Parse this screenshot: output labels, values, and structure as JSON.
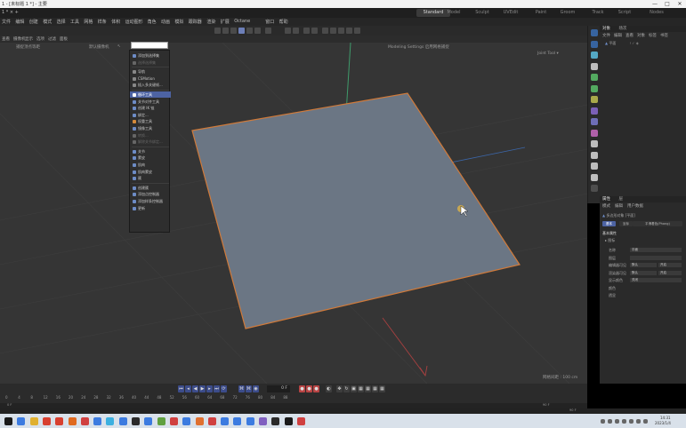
{
  "window": {
    "title": "1 - [未标题 1 *] - 主要",
    "controls": [
      "—",
      "□",
      "✕"
    ]
  },
  "tabbar": {
    "left_text": "1 *  ×  +",
    "layouts": [
      "Standard",
      "Model",
      "Sculpt",
      "UVEdit",
      "Paint",
      "Groom",
      "Track",
      "Script",
      "Nodes"
    ],
    "active_layout": "Standard"
  },
  "menubar": {
    "items": [
      "文件",
      "编辑",
      "创建",
      "模式",
      "选择",
      "工具",
      "网格",
      "样条",
      "体积",
      "运动图形",
      "角色",
      "动画",
      "模拟",
      "跟踪器",
      "渲染",
      "扩展",
      "Octane",
      "窗口",
      "帮助"
    ]
  },
  "viewport": {
    "menu": [
      "查看",
      "摄像机",
      "显示",
      "选项",
      "过滤",
      "面板"
    ],
    "camera_label": "默认摄像机",
    "snap_label": "捕捉顶点等距",
    "title": "Modeling Settings 启用网格捕捉",
    "right_label": "Joint Tool ▾",
    "grid_spacing": "网格间距 : 100 cm"
  },
  "popup": {
    "search_placeholder": "",
    "items": [
      {
        "label": "添加到选择集",
        "style": "normal",
        "icon_color": "#6d8cc6"
      },
      {
        "label": "选择选择集",
        "style": "dim",
        "icon_color": "#666"
      },
      {
        "label": "导航",
        "style": "normal",
        "icon_color": "#888"
      },
      {
        "label": "CSMotion",
        "style": "normal",
        "icon_color": "#888"
      },
      {
        "label": "插入多关键帧...",
        "style": "normal",
        "icon_color": "#888"
      },
      {
        "label": "循环工具",
        "style": "highlight",
        "icon_color": "#ffffff"
      },
      {
        "label": "关节对齐工具",
        "style": "normal",
        "icon_color": "#6d8cc6"
      },
      {
        "label": "创建 IK 链",
        "style": "normal",
        "icon_color": "#6d8cc6"
      },
      {
        "label": "绑定...",
        "style": "normal",
        "icon_color": "#6d8cc6"
      },
      {
        "label": "权重工具",
        "style": "normal",
        "icon_color": "#d48a3a"
      },
      {
        "label": "镜像工具",
        "style": "normal",
        "icon_color": "#6d8cc6"
      },
      {
        "label": "转换...",
        "style": "dim",
        "icon_color": "#666"
      },
      {
        "label": "解除关节绑定...",
        "style": "dim",
        "icon_color": "#666"
      },
      {
        "label": "关节",
        "style": "normal",
        "icon_color": "#6d8cc6"
      },
      {
        "label": "蒙皮",
        "style": "normal",
        "icon_color": "#6d8cc6"
      },
      {
        "label": "肌肉",
        "style": "normal",
        "icon_color": "#6d8cc6"
      },
      {
        "label": "肌肉蒙皮",
        "style": "normal",
        "icon_color": "#6d8cc6"
      },
      {
        "label": "簇",
        "style": "normal",
        "icon_color": "#6d8cc6"
      },
      {
        "label": "创建簇",
        "style": "normal",
        "icon_color": "#6d8cc6"
      },
      {
        "label": "添加点控制器",
        "style": "normal",
        "icon_color": "#6d8cc6"
      },
      {
        "label": "添加样条控制器",
        "style": "normal",
        "icon_color": "#6d8cc6"
      },
      {
        "label": "更新",
        "style": "normal",
        "icon_color": "#6d8cc6"
      }
    ]
  },
  "objects_panel": {
    "tabs": [
      "对象",
      "场次"
    ],
    "menu": [
      "文件",
      "编辑",
      "查看",
      "对象",
      "标签",
      "书签"
    ],
    "items": [
      {
        "name": "平面"
      }
    ]
  },
  "attributes_panel": {
    "tabs": [
      "属性",
      "层"
    ],
    "menu": [
      "模式",
      "编辑",
      "用户数据"
    ],
    "object_title": "多边形对象 [平面]",
    "subtabs": [
      "基本",
      "坐标",
      "平滑着色(Phong)"
    ],
    "section": "基本属性",
    "subsection": "图标",
    "fields": [
      {
        "label": "名称",
        "value": "平面"
      },
      {
        "label": "图层",
        "value": ""
      },
      {
        "label": "编辑器可见",
        "value": "默认",
        "extra": "开启"
      },
      {
        "label": "渲染器可见",
        "value": "默认",
        "extra": "开启"
      },
      {
        "label": "显示颜色",
        "value": "关闭"
      },
      {
        "label": "颜色",
        "value": ""
      },
      {
        "label": "透显",
        "value": ""
      }
    ]
  },
  "timeline": {
    "current_frame": "0 F",
    "ticks": [
      "0",
      "4",
      "8",
      "12",
      "16",
      "20",
      "24",
      "28",
      "32",
      "36",
      "40",
      "44",
      "48",
      "52",
      "56",
      "60",
      "64",
      "68",
      "72",
      "76",
      "80",
      "84",
      "88"
    ],
    "start": "0 F",
    "end_left": "90 F",
    "end_right": "90 F"
  },
  "colors": {
    "viewport_bg": "#353535",
    "plane_fill": "#6b7684",
    "plane_edge": "#d07a3a",
    "highlight": "#4d63a3",
    "taskbar_bg": "#d9e1ea"
  },
  "taskbar": {
    "time": "14:31",
    "date": "2023/1/4"
  }
}
